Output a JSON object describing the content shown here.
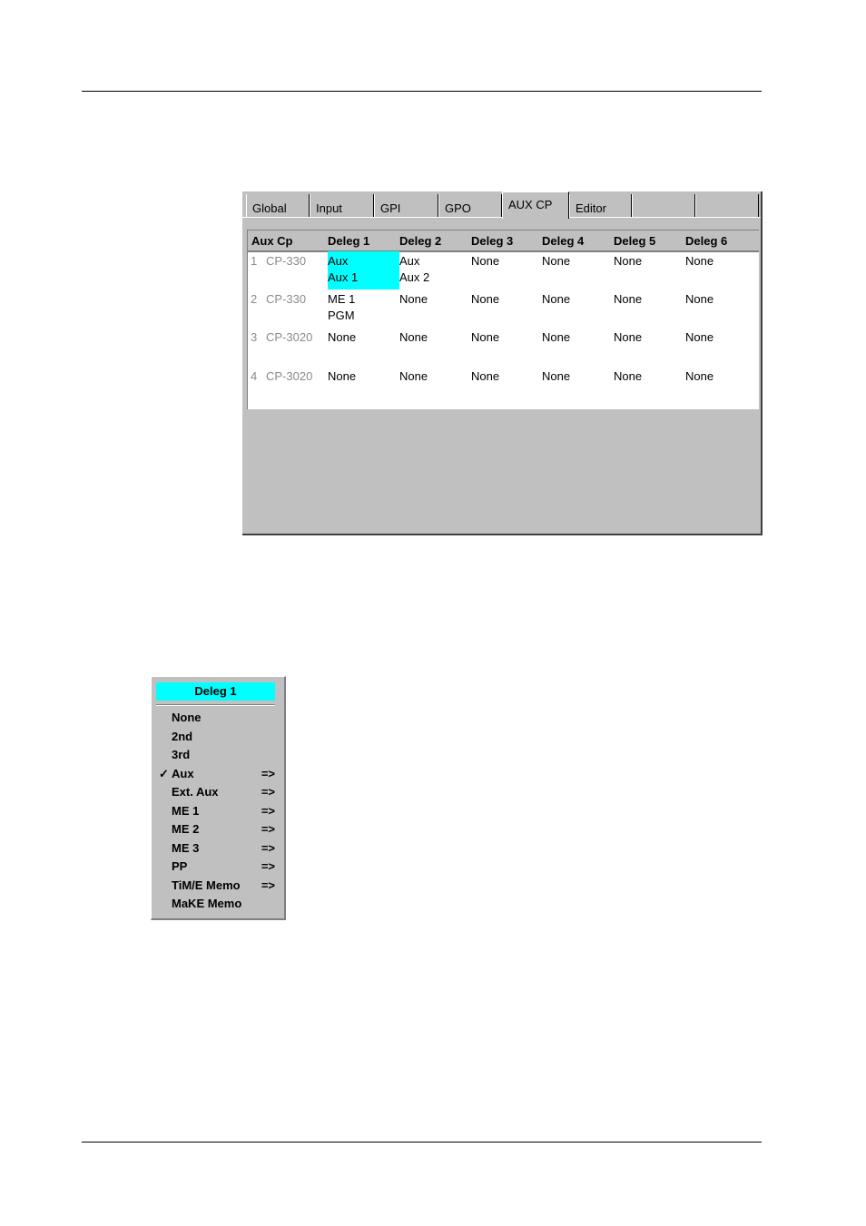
{
  "tabs": [
    "Global",
    "Input",
    "GPI",
    "GPO",
    "AUX CP",
    "Editor",
    "",
    ""
  ],
  "active_tab": "AUX CP",
  "table": {
    "headers": [
      "Aux Cp",
      "Deleg 1",
      "Deleg 2",
      "Deleg 3",
      "Deleg 4",
      "Deleg 5",
      "Deleg 6"
    ],
    "rows": [
      {
        "num": "1",
        "cp": "CP-330",
        "cells": [
          "Aux\nAux 1",
          "Aux\nAux 2",
          "None",
          "None",
          "None",
          "None"
        ],
        "selected_col": 0
      },
      {
        "num": "2",
        "cp": "CP-330",
        "cells": [
          "ME 1\nPGM",
          "None",
          "None",
          "None",
          "None",
          "None"
        ]
      },
      {
        "num": "3",
        "cp": "CP-3020",
        "cells": [
          "None",
          "None",
          "None",
          "None",
          "None",
          "None"
        ]
      },
      {
        "num": "4",
        "cp": "CP-3020",
        "cells": [
          "None",
          "None",
          "None",
          "None",
          "None",
          "None"
        ]
      }
    ]
  },
  "menu": {
    "title": "Deleg 1",
    "items": [
      {
        "label": "None",
        "checked": false,
        "submenu": ""
      },
      {
        "label": "2nd",
        "checked": false,
        "submenu": ""
      },
      {
        "label": "3rd",
        "checked": false,
        "submenu": ""
      },
      {
        "label": "Aux",
        "checked": true,
        "submenu": "=>"
      },
      {
        "label": "Ext. Aux",
        "checked": false,
        "submenu": "=>"
      },
      {
        "label": "ME 1",
        "checked": false,
        "submenu": "=>"
      },
      {
        "label": "ME 2",
        "checked": false,
        "submenu": "=>"
      },
      {
        "label": "ME 3",
        "checked": false,
        "submenu": "=>"
      },
      {
        "label": "PP",
        "checked": false,
        "submenu": "=>"
      },
      {
        "label": "TiM/E Memo",
        "checked": false,
        "submenu": "=>"
      },
      {
        "label": "MaKE Memo",
        "checked": false,
        "submenu": ""
      }
    ],
    "check_glyph": "✓"
  },
  "colors": {
    "highlight": "#00ffff",
    "panel": "#c0c0c0"
  }
}
